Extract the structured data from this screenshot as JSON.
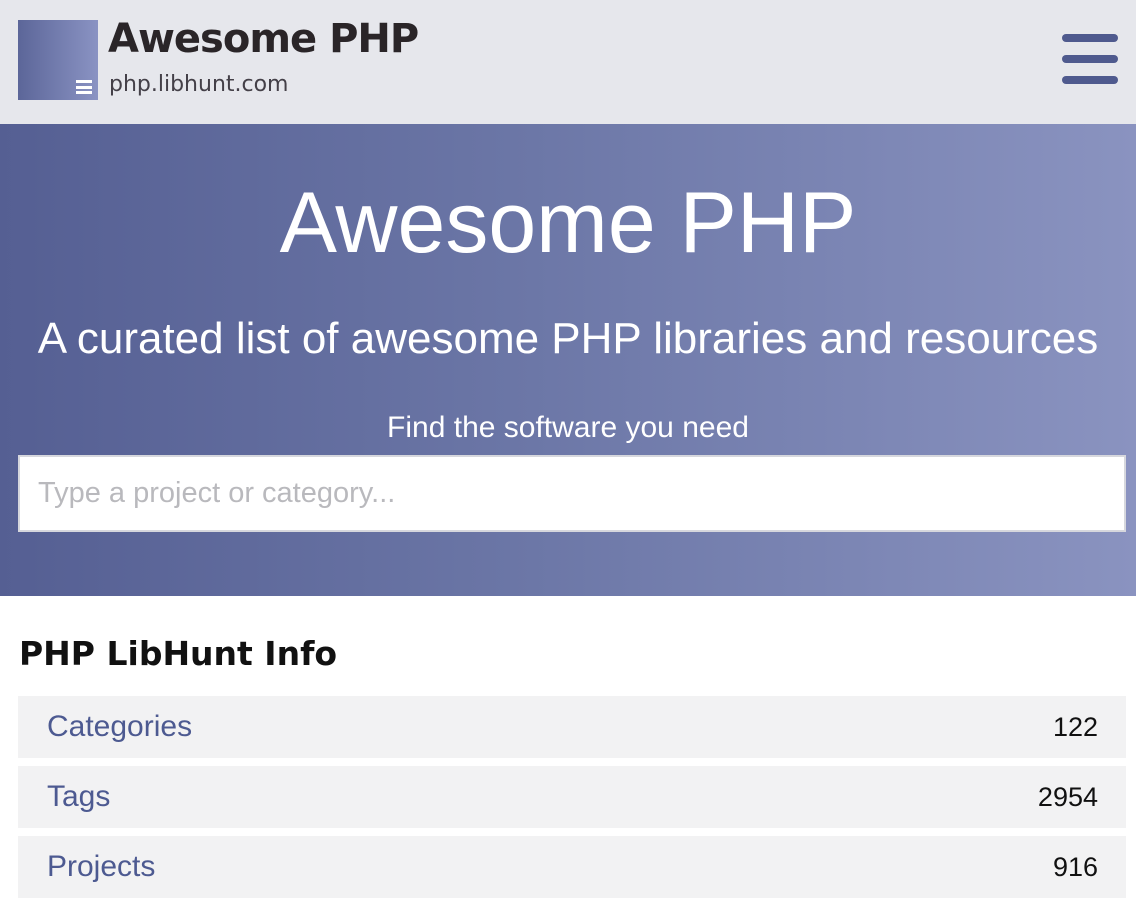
{
  "header": {
    "brand_title": "Awesome PHP",
    "brand_subtitle": "php.libhunt.com",
    "logo_icon": "menu-lines-icon",
    "menu_icon": "hamburger-menu-icon",
    "colors": {
      "background": "#e6e7ec",
      "accent": "#4f5a8e",
      "title": "#2a2528"
    }
  },
  "hero": {
    "title": "Awesome PHP",
    "subtitle": "A curated list of awesome PHP libraries and resources",
    "search_label": "Find the software you need",
    "search_placeholder": "Type a project or category...",
    "search_value": "",
    "colors": {
      "gradient_start": "#555f93",
      "gradient_end": "#8a93c0"
    }
  },
  "info": {
    "heading": "PHP LibHunt Info",
    "rows": [
      {
        "label": "Categories",
        "count": "122"
      },
      {
        "label": "Tags",
        "count": "2954"
      },
      {
        "label": "Projects",
        "count": "916"
      }
    ],
    "colors": {
      "row_background": "#f2f2f3",
      "link": "#4d5a91"
    }
  }
}
